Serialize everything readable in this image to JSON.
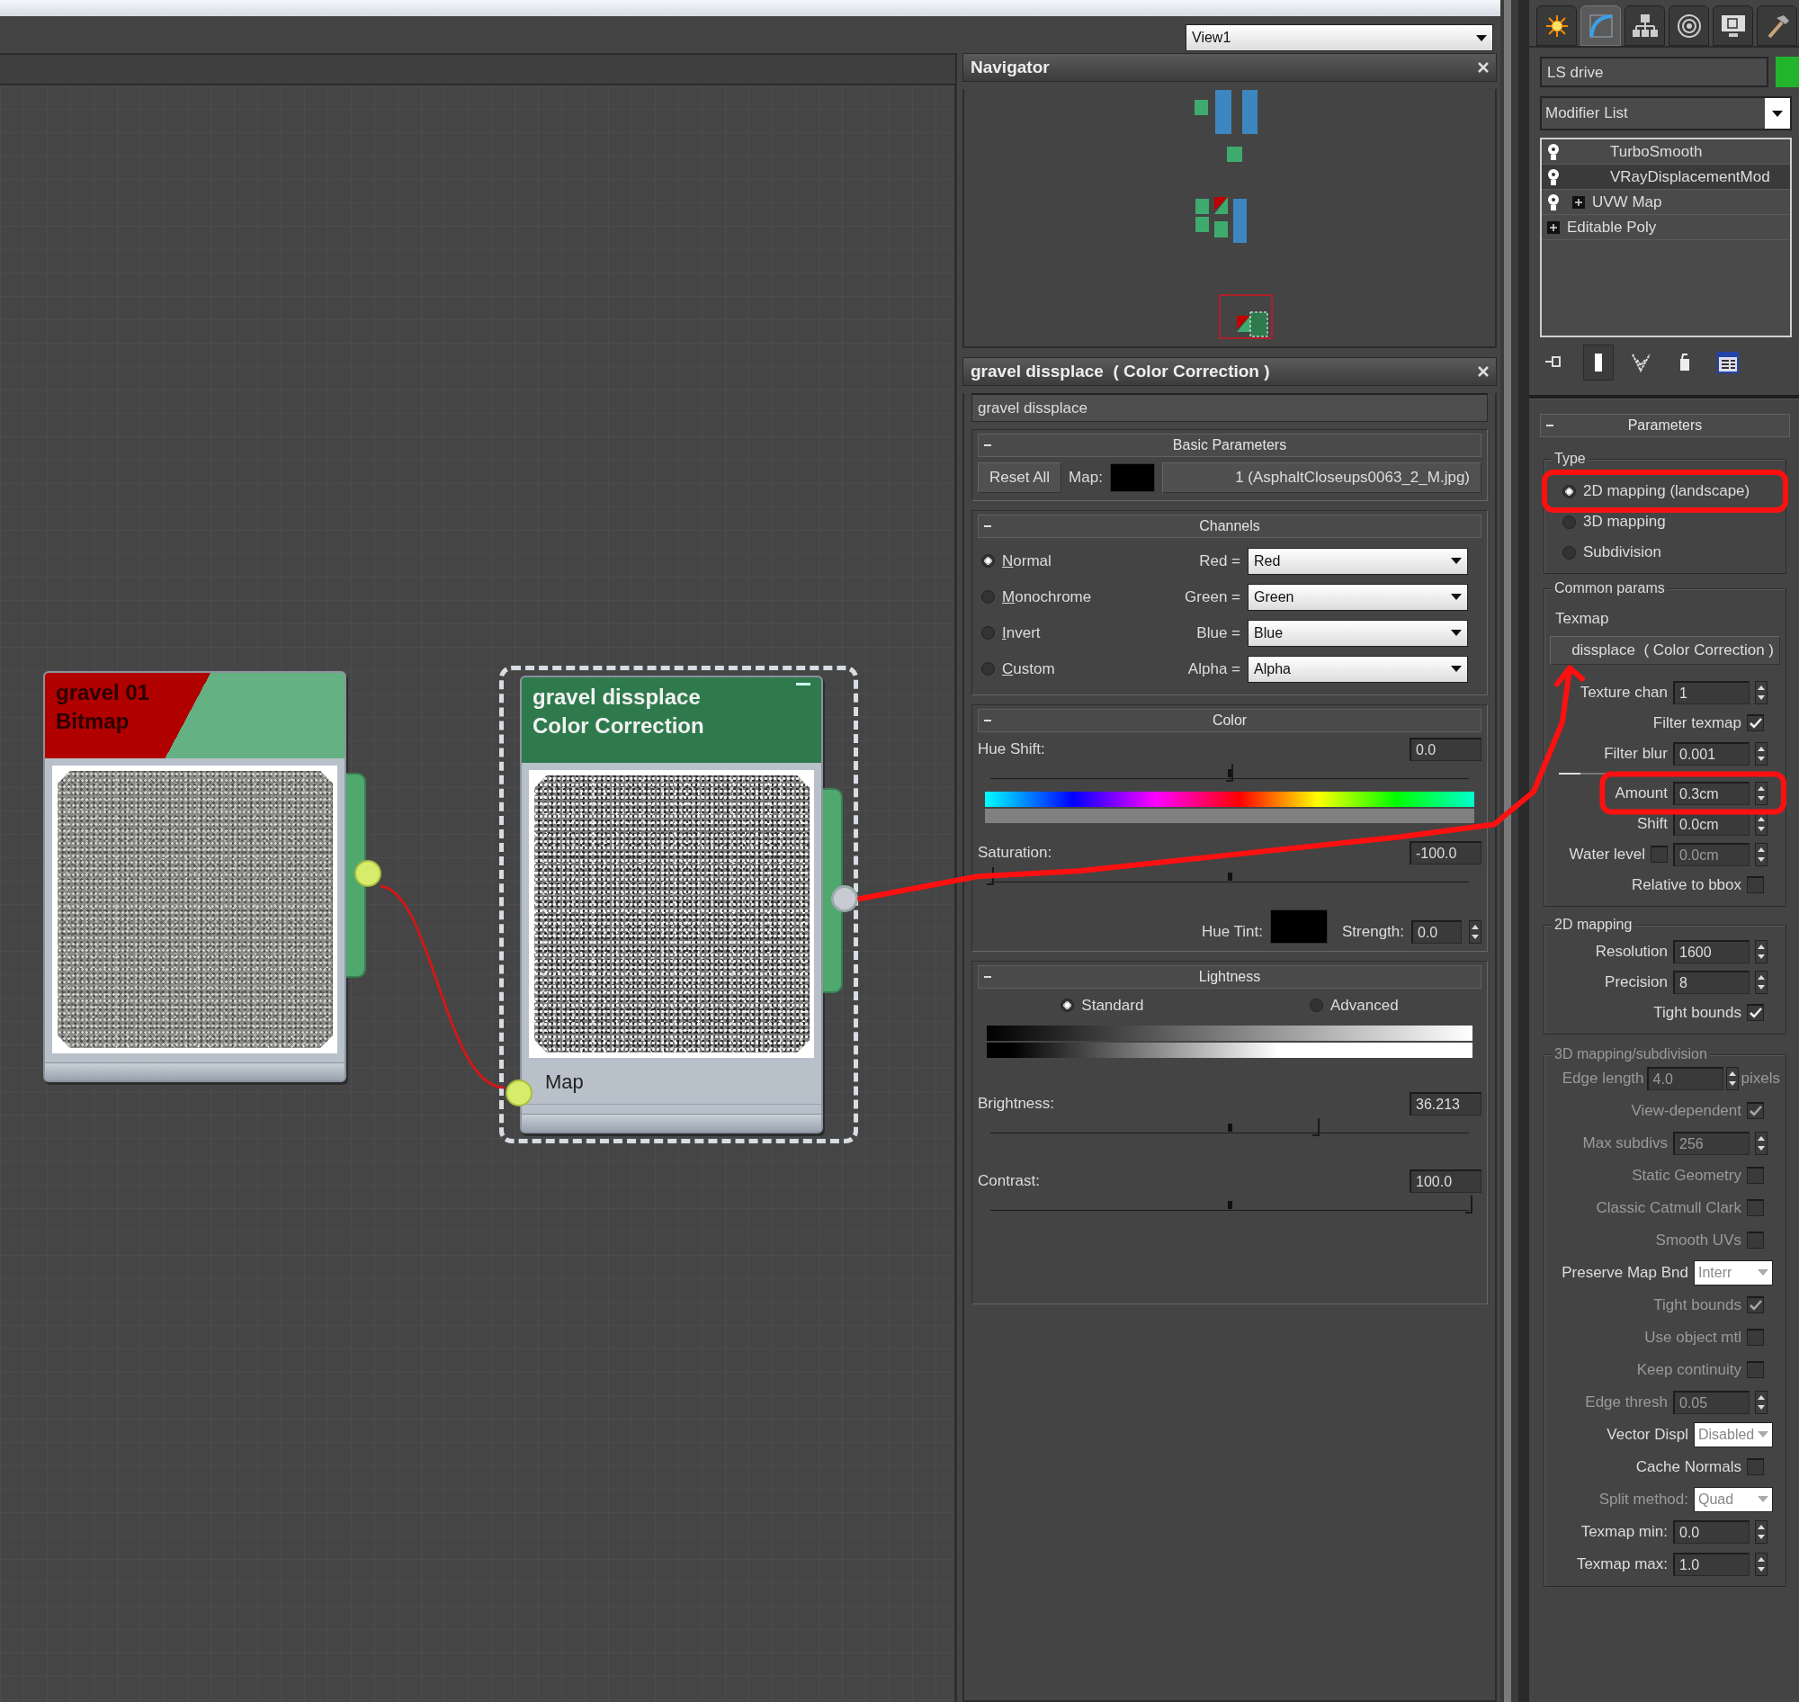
{
  "view_select": {
    "value": "View1"
  },
  "node_editor": {
    "nodes": [
      {
        "kind": "bitmap",
        "title": "gravel 01",
        "subtitle": "Bitmap",
        "selected": false,
        "output_connected": true
      },
      {
        "kind": "color_correction",
        "title": "gravel dissplace",
        "subtitle": "Color Correction",
        "selected": true,
        "output_connected": false,
        "inputs": [
          {
            "label": "Map",
            "connected": true
          }
        ]
      }
    ]
  },
  "navigator": {
    "title": "Navigator"
  },
  "material_editor": {
    "title": "gravel dissplace  ( Color Correction )",
    "name": "gravel dissplace",
    "basic_parameters": {
      "title": "Basic Parameters",
      "reset_button": "Reset All",
      "map_label": "Map:",
      "map_button": "1 (AsphaltCloseups0063_2_M.jpg)"
    },
    "channels": {
      "title": "Channels",
      "modes": [
        {
          "label": "Normal",
          "selected": true
        },
        {
          "label": "Monochrome",
          "selected": false
        },
        {
          "label": "Invert",
          "selected": false
        },
        {
          "label": "Custom",
          "selected": false
        }
      ],
      "mappings": [
        {
          "label": "Red =",
          "value": "Red"
        },
        {
          "label": "Green =",
          "value": "Green"
        },
        {
          "label": "Blue =",
          "value": "Blue"
        },
        {
          "label": "Alpha =",
          "value": "Alpha"
        }
      ]
    },
    "color": {
      "title": "Color",
      "hue_shift": {
        "label": "Hue Shift:",
        "value": "0.0",
        "level": 0.5
      },
      "saturation": {
        "label": "Saturation:",
        "value": "-100.0",
        "level": 0.0
      },
      "hue_tint_label": "Hue Tint:",
      "strength_label": "Strength:",
      "strength_value": "0.0"
    },
    "lightness": {
      "title": "Lightness",
      "modes": [
        {
          "label": "Standard",
          "selected": true
        },
        {
          "label": "Advanced",
          "selected": false
        }
      ],
      "brightness": {
        "label": "Brightness:",
        "value": "36.213",
        "level": 0.68
      },
      "contrast": {
        "label": "Contrast:",
        "value": "100.0",
        "level": 1.0
      }
    }
  },
  "command_panel": {
    "tabs": [
      {
        "kind": "create",
        "selected": false
      },
      {
        "kind": "modify",
        "selected": true
      },
      {
        "kind": "hierarchy",
        "selected": false
      },
      {
        "kind": "motion",
        "selected": false
      },
      {
        "kind": "display",
        "selected": false
      },
      {
        "kind": "utilities",
        "selected": false
      }
    ],
    "object_name": "LS drive",
    "modifier_list": "Modifier List",
    "stack": [
      {
        "label": "TurboSmooth",
        "has_bulb": true,
        "expandable": false,
        "selected": false
      },
      {
        "label": "VRayDisplacementMod",
        "has_bulb": true,
        "expandable": false,
        "selected": true
      },
      {
        "label": "UVW Map",
        "has_bulb": true,
        "expandable": true,
        "selected": false
      },
      {
        "label": "Editable Poly",
        "has_bulb": false,
        "expandable": true,
        "selected": false
      }
    ],
    "stack_tools": [
      {
        "kind": "pin",
        "pressed": false
      },
      {
        "kind": "show_end_result",
        "pressed": true
      },
      {
        "kind": "make_unique",
        "pressed": false
      },
      {
        "kind": "remove",
        "pressed": false
      },
      {
        "kind": "configure",
        "pressed": false
      }
    ],
    "parameters": {
      "title": "Parameters",
      "type_group": {
        "title": "Type",
        "options": [
          {
            "label": "2D mapping (landscape)",
            "selected": true
          },
          {
            "label": "3D mapping",
            "selected": false
          },
          {
            "label": "Subdivision",
            "selected": false
          }
        ]
      },
      "common": {
        "title": "Common params",
        "texmap_label": "Texmap",
        "texmap_button": "dissplace  ( Color Correction )",
        "rows": [
          {
            "kind": "spinner",
            "label": "Texture chan",
            "value": "1",
            "disabled": false
          },
          {
            "kind": "checkbox",
            "label": "Filter texmap",
            "checked": true,
            "disabled": false
          },
          {
            "kind": "spinner",
            "label": "Filter blur",
            "value": "0.001",
            "disabled": false
          },
          {
            "kind": "separator"
          },
          {
            "kind": "spinner",
            "label": "Amount",
            "value": "0.3cm",
            "disabled": false
          },
          {
            "kind": "spinner",
            "label": "Shift",
            "value": "0.0cm",
            "disabled": false
          },
          {
            "kind": "check_spinner",
            "label": "Water level",
            "checked": false,
            "value": "0.0cm",
            "disabled": false
          },
          {
            "kind": "checkbox",
            "label": "Relative to bbox",
            "checked": false,
            "disabled": false
          }
        ]
      },
      "mapping_2d": {
        "title": "2D mapping",
        "rows": [
          {
            "kind": "spinner",
            "label": "Resolution",
            "value": "1600",
            "disabled": false
          },
          {
            "kind": "spinner",
            "label": "Precision",
            "value": "8",
            "disabled": false
          },
          {
            "kind": "checkbox",
            "label": "Tight bounds",
            "checked": true,
            "disabled": false
          }
        ]
      },
      "mapping_3d": {
        "title": "3D mapping/subdivision",
        "rows": [
          {
            "kind": "spinner",
            "label": "Edge length",
            "value": "4.0",
            "unit": "pixels",
            "disabled": true
          },
          {
            "kind": "checkbox",
            "label": "View-dependent",
            "checked": true,
            "disabled": true
          },
          {
            "kind": "spinner",
            "label": "Max subdivs",
            "value": "256",
            "disabled": true
          },
          {
            "kind": "checkbox",
            "label": "Static Geometry",
            "checked": false,
            "disabled": true
          },
          {
            "kind": "checkbox",
            "label": "Classic Catmull Clark",
            "checked": false,
            "disabled": true
          },
          {
            "kind": "checkbox",
            "label": "Smooth UVs",
            "checked": false,
            "disabled": true
          },
          {
            "kind": "dropdown",
            "label": "Preserve Map Bnd",
            "value": "Interr",
            "disabled": false
          },
          {
            "kind": "checkbox",
            "label": "Tight bounds",
            "checked": true,
            "disabled": true
          },
          {
            "kind": "checkbox",
            "label": "Use object mtl",
            "checked": false,
            "disabled": true
          },
          {
            "kind": "checkbox",
            "label": "Keep continuity",
            "checked": false,
            "disabled": true
          },
          {
            "kind": "spinner",
            "label": "Edge thresh",
            "value": "0.05",
            "disabled": true
          },
          {
            "kind": "dropdown",
            "label": "Vector Displ",
            "value": "Disabled",
            "disabled": false
          },
          {
            "kind": "checkbox",
            "label": "Cache Normals",
            "checked": false,
            "disabled": false
          },
          {
            "kind": "dropdown",
            "label": "Split method:",
            "value": "Quad",
            "disabled": true
          },
          {
            "kind": "spinner",
            "label": "Texmap min:",
            "value": "0.0",
            "disabled": false
          },
          {
            "kind": "spinner",
            "label": "Texmap max:",
            "value": "1.0",
            "disabled": false
          }
        ]
      }
    }
  }
}
